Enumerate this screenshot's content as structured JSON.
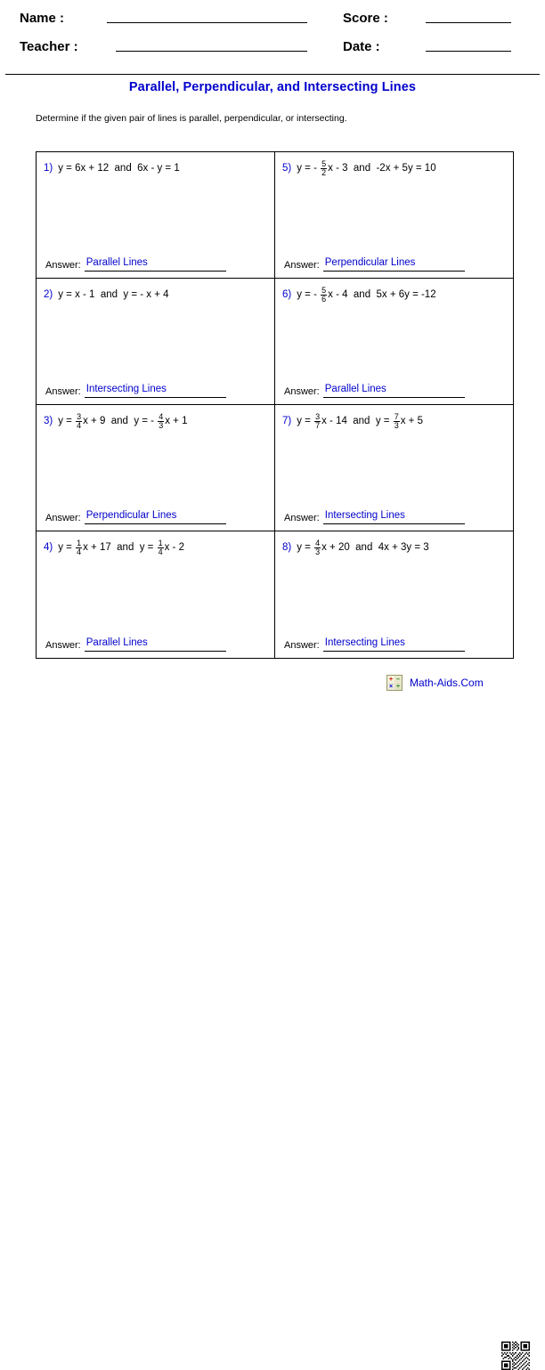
{
  "header": {
    "name_label": "Name :",
    "teacher_label": "Teacher :",
    "score_label": "Score :",
    "date_label": "Date :",
    "name_value": "",
    "teacher_value": "",
    "score_value": "",
    "date_value": ""
  },
  "title": "Parallel, Perpendicular, and Intersecting Lines",
  "instructions": "Determine if the given pair of lines is parallel, perpendicular, or intersecting.",
  "answer_label": "Answer:",
  "colors": {
    "accent_blue": "#0000CC",
    "text_black": "#000000",
    "border_black": "#000000"
  },
  "problems": [
    {
      "number": "1)",
      "parts": [
        {
          "t": "text",
          "v": "y = 6x + 12  and  6x - y = 1"
        }
      ],
      "answer": "Parallel Lines"
    },
    {
      "number": "5)",
      "parts": [
        {
          "t": "text",
          "v": "y = - "
        },
        {
          "t": "frac",
          "num": "5",
          "den": "2"
        },
        {
          "t": "text",
          "v": "x - 3  and  -2x + 5y = 10"
        }
      ],
      "answer": "Perpendicular Lines"
    },
    {
      "number": "2)",
      "parts": [
        {
          "t": "text",
          "v": "y = x - 1  and  y = - x + 4"
        }
      ],
      "answer": "Intersecting Lines"
    },
    {
      "number": "6)",
      "parts": [
        {
          "t": "text",
          "v": "y = - "
        },
        {
          "t": "frac",
          "num": "5",
          "den": "6"
        },
        {
          "t": "text",
          "v": "x - 4  and  5x + 6y = -12"
        }
      ],
      "answer": "Parallel Lines"
    },
    {
      "number": "3)",
      "parts": [
        {
          "t": "text",
          "v": "y = "
        },
        {
          "t": "frac",
          "num": "3",
          "den": "4"
        },
        {
          "t": "text",
          "v": "x + 9  and  y = - "
        },
        {
          "t": "frac",
          "num": "4",
          "den": "3"
        },
        {
          "t": "text",
          "v": "x + 1"
        }
      ],
      "answer": "Perpendicular Lines"
    },
    {
      "number": "7)",
      "parts": [
        {
          "t": "text",
          "v": "y = "
        },
        {
          "t": "frac",
          "num": "3",
          "den": "7"
        },
        {
          "t": "text",
          "v": "x - 14  and  y = "
        },
        {
          "t": "frac",
          "num": "7",
          "den": "3"
        },
        {
          "t": "text",
          "v": "x + 5"
        }
      ],
      "answer": "Intersecting Lines"
    },
    {
      "number": "4)",
      "parts": [
        {
          "t": "text",
          "v": "y = "
        },
        {
          "t": "frac",
          "num": "1",
          "den": "4"
        },
        {
          "t": "text",
          "v": "x + 17  and  y = "
        },
        {
          "t": "frac",
          "num": "1",
          "den": "4"
        },
        {
          "t": "text",
          "v": "x - 2"
        }
      ],
      "answer": "Parallel Lines"
    },
    {
      "number": "8)",
      "parts": [
        {
          "t": "text",
          "v": "y = "
        },
        {
          "t": "frac",
          "num": "4",
          "den": "3"
        },
        {
          "t": "text",
          "v": "x + 20  and  4x + 3y = 3"
        }
      ],
      "answer": "Intersecting Lines"
    }
  ],
  "footer": {
    "brand_text": "Math-Aids.Com",
    "logo_glyphs": [
      "+",
      "–",
      "×",
      "÷"
    ],
    "qr_alt": "qr-code"
  }
}
